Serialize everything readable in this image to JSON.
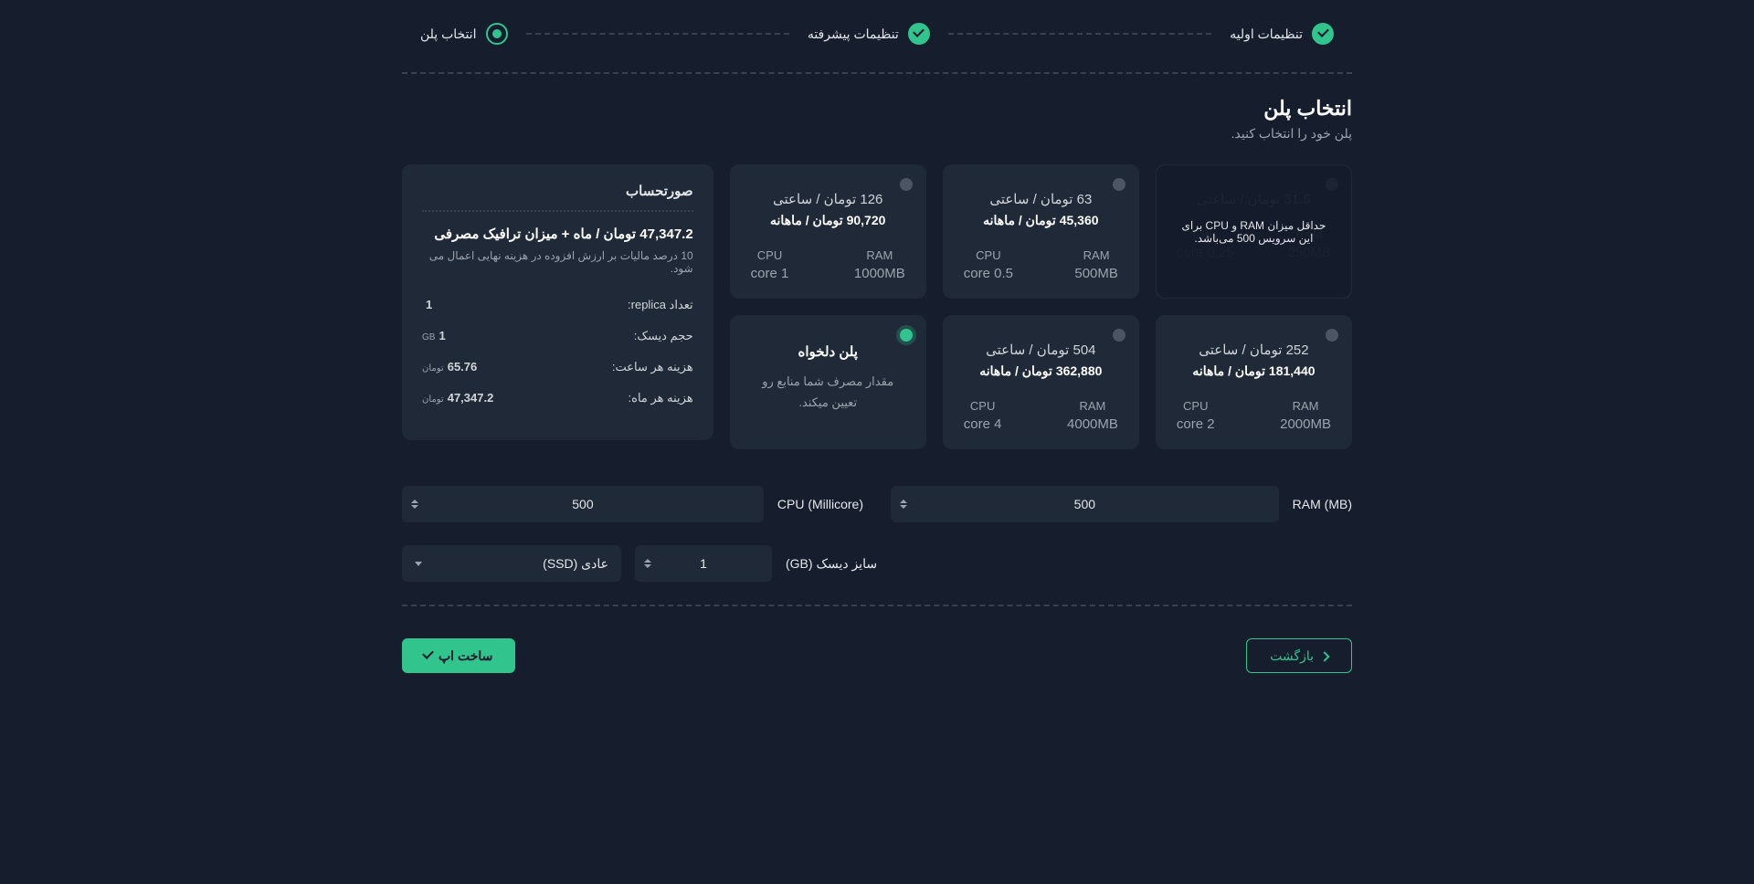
{
  "stepper": [
    {
      "label": "تنظیمات اولیه",
      "state": "done"
    },
    {
      "label": "تنظیمات پیشرفته",
      "state": "done"
    },
    {
      "label": "انتخاب پلن",
      "state": "current"
    }
  ],
  "heading": {
    "title": "انتخاب پلن",
    "subtitle": "پلن خود را انتخاب کنید."
  },
  "plans": [
    {
      "id": "p1",
      "hourly": "31.5 تومان / ساعتی",
      "monthly": "",
      "ram": "250MB",
      "cpu": "0.25 core",
      "disabled": true,
      "selected": false,
      "overlay": "حداقل میزان RAM و CPU برای این سرویس 500 می‌باشد."
    },
    {
      "id": "p2",
      "hourly": "63 تومان / ساعتی",
      "monthly": "45,360 تومان / ماهانه",
      "ram": "500MB",
      "cpu": "0.5 core",
      "disabled": false,
      "selected": false
    },
    {
      "id": "p3",
      "hourly": "126 تومان / ساعتی",
      "monthly": "90,720 تومان / ماهانه",
      "ram": "1000MB",
      "cpu": "1 core",
      "disabled": false,
      "selected": false
    },
    {
      "id": "p4",
      "hourly": "252 تومان / ساعتی",
      "monthly": "181,440 تومان / ماهانه",
      "ram": "2000MB",
      "cpu": "2 core",
      "disabled": false,
      "selected": false
    },
    {
      "id": "p5",
      "hourly": "504 تومان / ساعتی",
      "monthly": "362,880 تومان / ماهانه",
      "ram": "4000MB",
      "cpu": "4 core",
      "disabled": false,
      "selected": false
    },
    {
      "id": "custom",
      "custom": true,
      "title": "پلن دلخواه",
      "desc": "مقدار مصرف شما منابع رو تعیین میکند.",
      "selected": true
    }
  ],
  "labels": {
    "ram": "RAM",
    "cpu": "CPU"
  },
  "summary": {
    "title": "صورتحساب",
    "headline": "47,347.2 تومان / ماه   +  میزان ترافیک مصرفی",
    "sub": "10 درصد مالیات بر ارزش افزوده در هزینه نهایی اعمال می شود.",
    "rows": [
      {
        "k": "تعداد replica:",
        "v": "1",
        "u": ""
      },
      {
        "k": "حجم دیسک:",
        "v": "1",
        "u": "GB"
      },
      {
        "k": "هزینه هر ساعت:",
        "v": "65.76",
        "u": "تومان"
      },
      {
        "k": "هزینه هر ماه:",
        "v": "47,347.2",
        "u": "تومان"
      }
    ]
  },
  "inputs": {
    "ram": {
      "label": "RAM (MB)",
      "value": "500"
    },
    "cpu": {
      "label": "CPU (Millicore)",
      "value": "500"
    },
    "disk": {
      "label": "سایز دیسک (GB)",
      "value": "1"
    },
    "diskType": {
      "label": "",
      "selected": "عادی (SSD)"
    }
  },
  "actions": {
    "back": "بازگشت",
    "submit": "ساخت اپ"
  }
}
